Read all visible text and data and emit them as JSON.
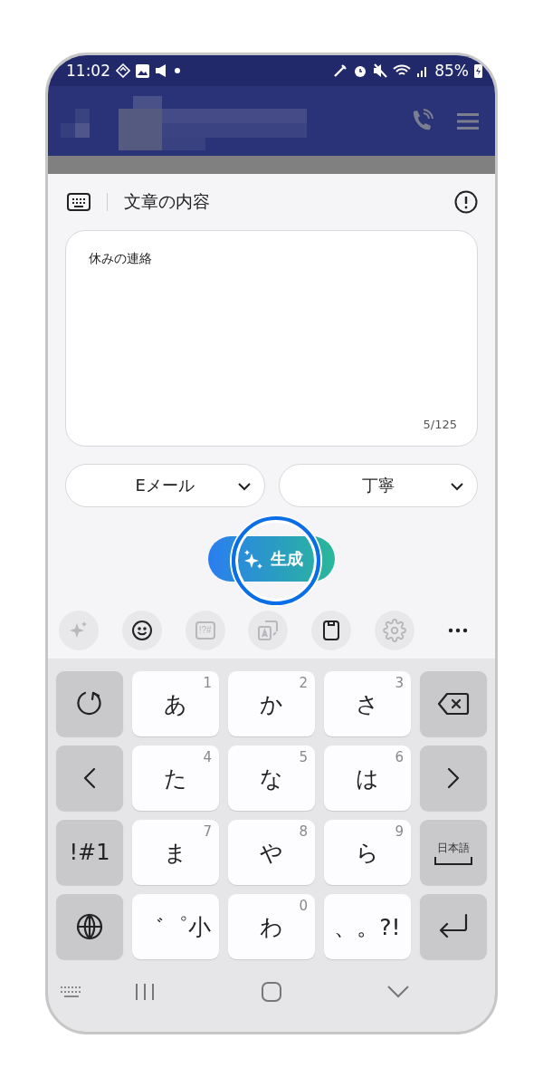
{
  "status_bar": {
    "time": "11:02",
    "battery": "85%"
  },
  "composer": {
    "title": "文章の内容",
    "text": "休みの連絡",
    "counter": "5/125",
    "dropdowns": [
      {
        "value": "Eメール"
      },
      {
        "value": "丁寧"
      }
    ],
    "generate": {
      "label": "生成",
      "highlighted": true
    }
  },
  "toolbar": [
    {
      "kind": "ai",
      "disabled": true
    },
    {
      "kind": "emoji",
      "disabled": false
    },
    {
      "kind": "symbols",
      "label": "!?#",
      "disabled": true
    },
    {
      "kind": "translate",
      "disabled": true
    },
    {
      "kind": "clipboard",
      "disabled": false
    },
    {
      "kind": "settings",
      "disabled": true
    },
    {
      "kind": "more",
      "disabled": false
    }
  ],
  "keyboard": [
    [
      {
        "kind": "undo"
      },
      {
        "kind": "char",
        "label": "あ",
        "num": "1"
      },
      {
        "kind": "char",
        "label": "か",
        "num": "2"
      },
      {
        "kind": "char",
        "label": "さ",
        "num": "3"
      },
      {
        "kind": "backspace"
      }
    ],
    [
      {
        "kind": "left"
      },
      {
        "kind": "char",
        "label": "た",
        "num": "4"
      },
      {
        "kind": "char",
        "label": "な",
        "num": "5"
      },
      {
        "kind": "char",
        "label": "は",
        "num": "6"
      },
      {
        "kind": "right"
      }
    ],
    [
      {
        "kind": "symbols",
        "label": "!#1"
      },
      {
        "kind": "char",
        "label": "ま",
        "num": "7"
      },
      {
        "kind": "char",
        "label": "や",
        "num": "8"
      },
      {
        "kind": "char",
        "label": "ら",
        "num": "9"
      },
      {
        "kind": "space",
        "label": "日本語"
      }
    ],
    [
      {
        "kind": "globe"
      },
      {
        "kind": "char",
        "label": "゛゜小"
      },
      {
        "kind": "char",
        "label": "わ",
        "num": "0"
      },
      {
        "kind": "char",
        "label": "、。?!"
      },
      {
        "kind": "enter"
      }
    ]
  ]
}
